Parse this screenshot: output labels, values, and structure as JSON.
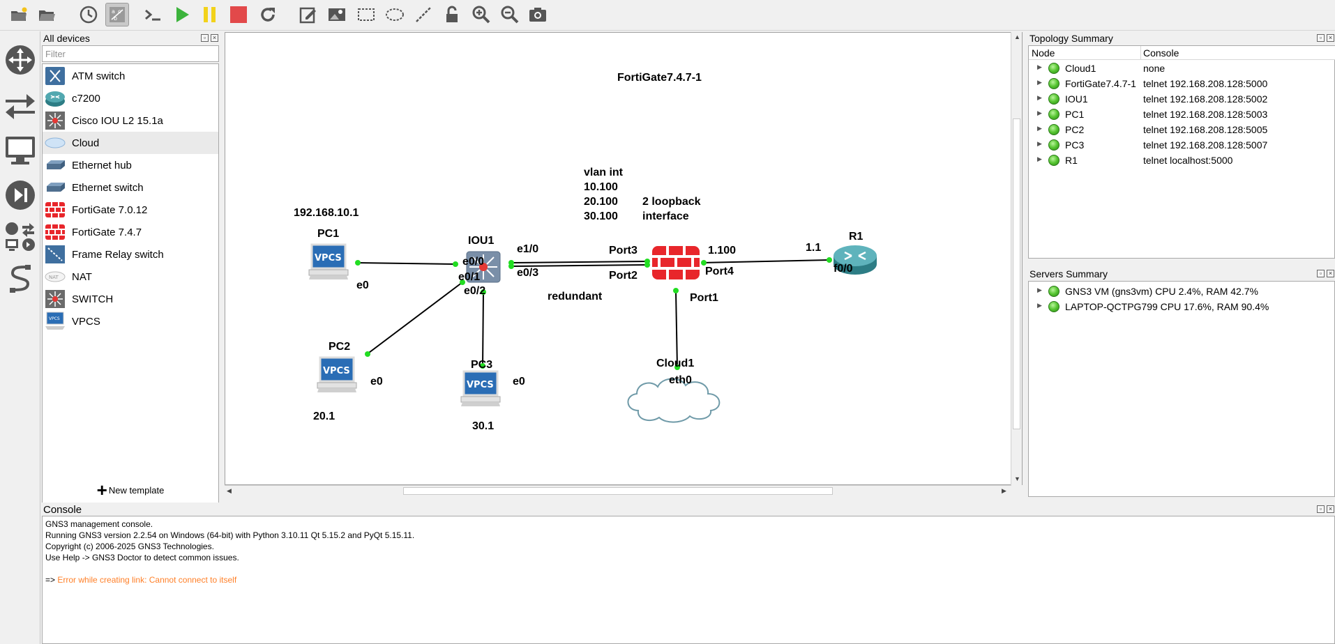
{
  "toolbar": {
    "buttons": [
      {
        "name": "new-project-icon",
        "icon": "folder-star"
      },
      {
        "name": "open-project-icon",
        "icon": "folder-open"
      },
      {
        "name": "snapshot-icon",
        "icon": "clock"
      },
      {
        "name": "show-interface-labels-icon",
        "icon": "abc-labels",
        "active": true
      },
      {
        "name": "console-all-icon",
        "icon": "terminal"
      },
      {
        "name": "start-all-icon",
        "icon": "play"
      },
      {
        "name": "suspend-all-icon",
        "icon": "pause"
      },
      {
        "name": "stop-all-icon",
        "icon": "stop"
      },
      {
        "name": "reload-all-icon",
        "icon": "reload"
      },
      {
        "name": "add-note-icon",
        "icon": "edit-note"
      },
      {
        "name": "insert-picture-icon",
        "icon": "picture"
      },
      {
        "name": "draw-rectangle-icon",
        "icon": "rectangle"
      },
      {
        "name": "draw-ellipse-icon",
        "icon": "ellipse"
      },
      {
        "name": "draw-line-icon",
        "icon": "line"
      },
      {
        "name": "lock-unlock-icon",
        "icon": "padlock"
      },
      {
        "name": "zoom-in-icon",
        "icon": "zoom-in"
      },
      {
        "name": "zoom-out-icon",
        "icon": "zoom-out"
      },
      {
        "name": "screenshot-icon",
        "icon": "camera"
      }
    ]
  },
  "left_dock": [
    "browse-routers-icon",
    "browse-switches-icon",
    "browse-end-devices-icon",
    "browse-security-devices-icon",
    "browse-all-devices-icon",
    "add-link-icon"
  ],
  "devices_panel": {
    "title": "All devices",
    "filter_placeholder": "Filter",
    "filter_value": "",
    "items": [
      {
        "label": "ATM switch",
        "icon": "atm-switch-icon"
      },
      {
        "label": "c7200",
        "icon": "router-icon"
      },
      {
        "label": "Cisco IOU L2 15.1a",
        "icon": "iou-switch-icon"
      },
      {
        "label": "Cloud",
        "icon": "cloud-icon",
        "selected": true
      },
      {
        "label": "Ethernet hub",
        "icon": "ethernet-hub-icon"
      },
      {
        "label": "Ethernet switch",
        "icon": "ethernet-switch-icon"
      },
      {
        "label": "FortiGate 7.0.12",
        "icon": "firewall-icon"
      },
      {
        "label": "FortiGate 7.4.7",
        "icon": "firewall-icon"
      },
      {
        "label": "Frame Relay switch",
        "icon": "frame-relay-switch-icon"
      },
      {
        "label": "NAT",
        "icon": "nat-icon"
      },
      {
        "label": "SWITCH",
        "icon": "switch-icon"
      },
      {
        "label": "VPCS",
        "icon": "vpcs-icon"
      }
    ],
    "new_template_label": "New template"
  },
  "canvas": {
    "nodes": {
      "pc1": "PC1",
      "pc2": "PC2",
      "pc3": "PC3",
      "iou1": "IOU1",
      "fortigate": "FortiGate7.4.7-1",
      "r1": "R1",
      "cloud1": "Cloud1"
    },
    "vpcs_text": "VPCS",
    "interfaces": {
      "pc1_e0": "e0",
      "pc2_e0": "e0",
      "pc3_e0": "e0",
      "iou_e00": "e0/0",
      "iou_e01": "e0/1",
      "iou_e02": "e0/2",
      "iou_e10": "e1/0",
      "iou_e03": "e0/3",
      "fg_port3": "Port3",
      "fg_port2": "Port2",
      "fg_port4": "Port4",
      "fg_port1": "Port1",
      "r1_f00": "f0/0",
      "cloud_eth0": "eth0"
    },
    "notes": {
      "pc1_ip": "192.168.10.1",
      "pc2_ip": "20.1",
      "pc3_ip": "30.1",
      "vlan_lines": [
        "vlan int",
        "10.100",
        "20.100",
        "30.100"
      ],
      "loopback_lines": [
        "2 loopback",
        "interface"
      ],
      "redundant": "redundant",
      "fg_ip": "1.100",
      "r1_ip": "1.1"
    }
  },
  "topology_summary": {
    "title": "Topology Summary",
    "columns": [
      "Node",
      "Console"
    ],
    "rows": [
      {
        "node": "Cloud1",
        "console": "none"
      },
      {
        "node": "FortiGate7.4.7-1",
        "console": "telnet 192.168.208.128:5000"
      },
      {
        "node": "IOU1",
        "console": "telnet 192.168.208.128:5002"
      },
      {
        "node": "PC1",
        "console": "telnet 192.168.208.128:5003"
      },
      {
        "node": "PC2",
        "console": "telnet 192.168.208.128:5005"
      },
      {
        "node": "PC3",
        "console": "telnet 192.168.208.128:5007"
      },
      {
        "node": "R1",
        "console": "telnet localhost:5000"
      }
    ]
  },
  "servers_summary": {
    "title": "Servers Summary",
    "rows": [
      "GNS3 VM (gns3vm) CPU 2.4%, RAM 42.7%",
      "LAPTOP-QCTPG799 CPU 17.6%, RAM 90.4%"
    ]
  },
  "console": {
    "title": "Console",
    "lines": [
      "GNS3 management console.",
      "Running GNS3 version 2.2.54 on Windows (64-bit) with Python 3.10.11 Qt 5.15.2 and PyQt 5.15.11.",
      "Copyright (c) 2006-2025 GNS3 Technologies.",
      "Use Help -> GNS3 Doctor to detect common issues."
    ],
    "prompt": "=>",
    "error": "Error while creating link: Cannot connect to itself"
  },
  "colors": {
    "link_dot": "#22dd22",
    "fortigate_red": "#e8262b",
    "error_orange": "#ff7f27",
    "vpcs_blue": "#2a6db5",
    "router_teal": "#3a8f9a"
  }
}
